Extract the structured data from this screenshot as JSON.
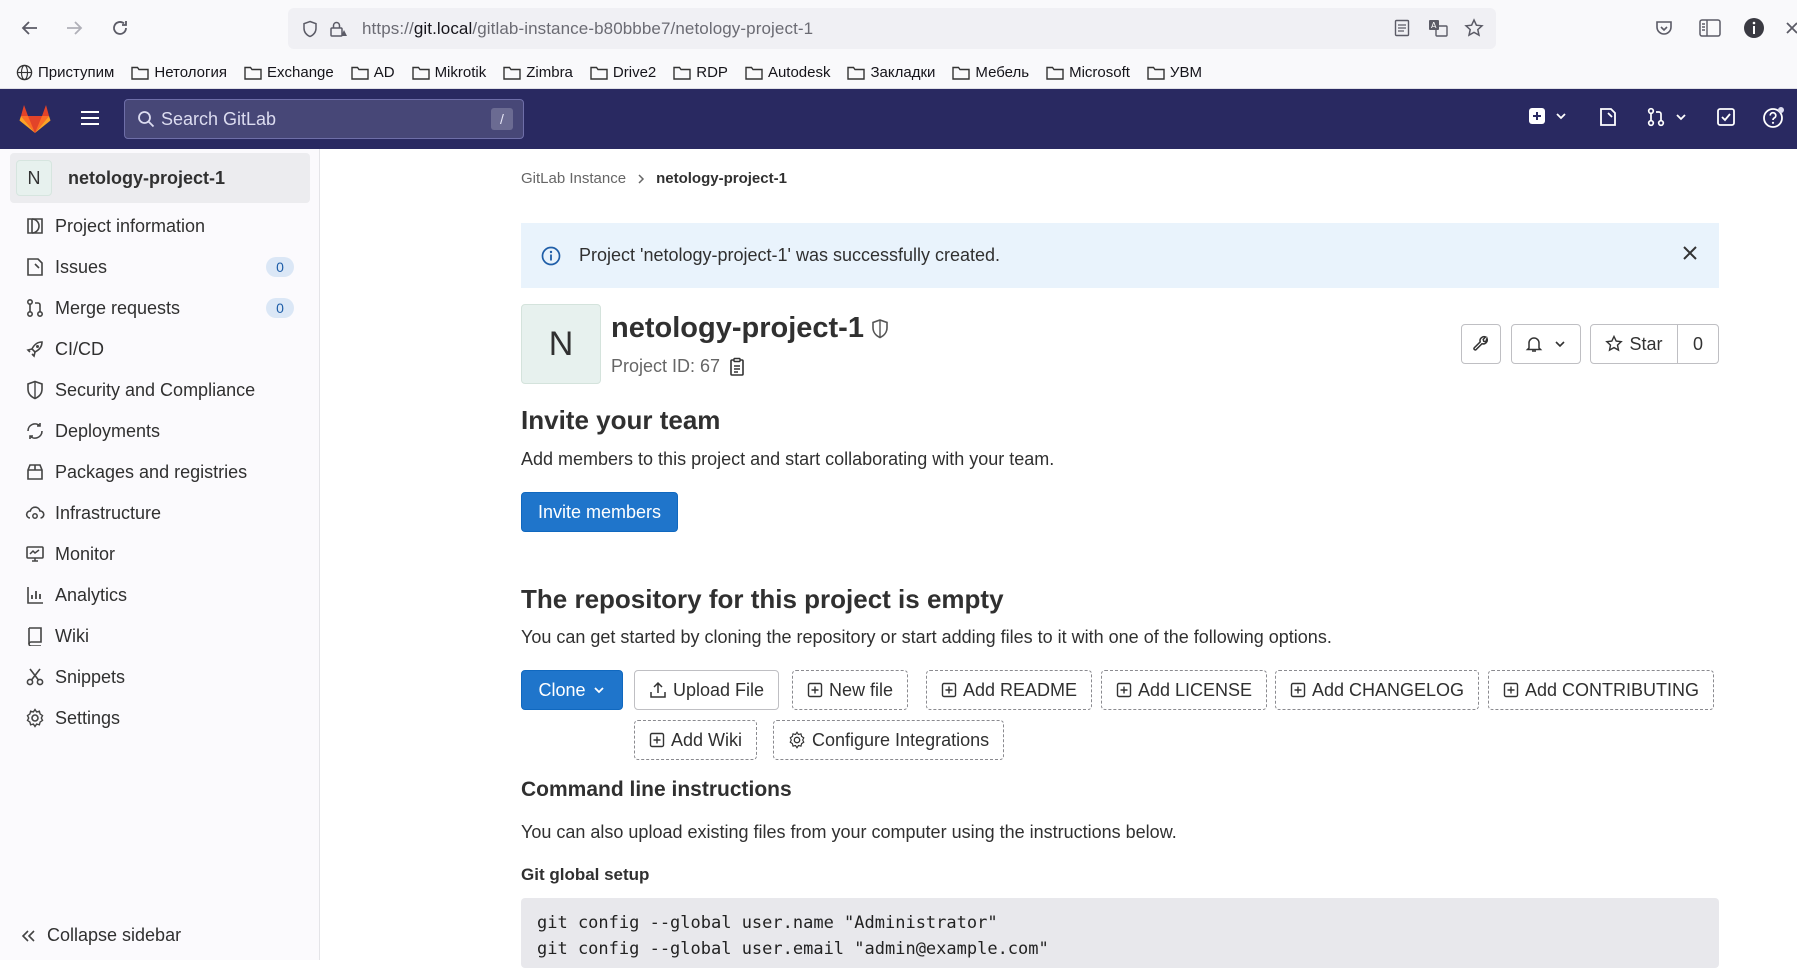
{
  "browser": {
    "url_prefix": "https://",
    "url_host": "git.local",
    "url_path": "/gitlab-instance-b80bbbe7/netology-project-1",
    "bookmarks": [
      {
        "label": "Приступим",
        "icon": "globe-icon"
      },
      {
        "label": "Нетология",
        "icon": "folder-icon"
      },
      {
        "label": "Exchange",
        "icon": "folder-icon"
      },
      {
        "label": "AD",
        "icon": "folder-icon"
      },
      {
        "label": "Mikrotik",
        "icon": "folder-icon"
      },
      {
        "label": "Zimbra",
        "icon": "folder-icon"
      },
      {
        "label": "Drive2",
        "icon": "folder-icon"
      },
      {
        "label": "RDP",
        "icon": "folder-icon"
      },
      {
        "label": "Autodesk",
        "icon": "folder-icon"
      },
      {
        "label": "Закладки",
        "icon": "folder-icon"
      },
      {
        "label": "Мебель",
        "icon": "folder-icon"
      },
      {
        "label": "Microsoft",
        "icon": "folder-icon"
      },
      {
        "label": "УВМ",
        "icon": "folder-icon"
      }
    ]
  },
  "header": {
    "search_placeholder": "Search GitLab",
    "search_shortcut": "/"
  },
  "sidebar": {
    "project_initial": "N",
    "project_name": "netology-project-1",
    "items": [
      {
        "label": "Project information",
        "icon": "info-icon"
      },
      {
        "label": "Issues",
        "icon": "issues-icon",
        "badge": "0"
      },
      {
        "label": "Merge requests",
        "icon": "merge-request-icon",
        "badge": "0"
      },
      {
        "label": "CI/CD",
        "icon": "rocket-icon"
      },
      {
        "label": "Security and Compliance",
        "icon": "shield-icon"
      },
      {
        "label": "Deployments",
        "icon": "deployments-icon"
      },
      {
        "label": "Packages and registries",
        "icon": "package-icon"
      },
      {
        "label": "Infrastructure",
        "icon": "cloud-gear-icon"
      },
      {
        "label": "Monitor",
        "icon": "monitor-icon"
      },
      {
        "label": "Analytics",
        "icon": "chart-icon"
      },
      {
        "label": "Wiki",
        "icon": "book-icon"
      },
      {
        "label": "Snippets",
        "icon": "scissors-icon"
      },
      {
        "label": "Settings",
        "icon": "gear-icon"
      }
    ],
    "collapse_label": "Collapse sidebar"
  },
  "main": {
    "breadcrumb": {
      "parent": "GitLab Instance",
      "current": "netology-project-1"
    },
    "alert": "Project 'netology-project-1' was successfully created.",
    "project": {
      "initial": "N",
      "title": "netology-project-1",
      "id_label": "Project ID: 67",
      "star_label": "Star",
      "star_count": "0"
    },
    "invite": {
      "heading": "Invite your team",
      "text": "Add members to this project and start collaborating with your team.",
      "button": "Invite members"
    },
    "empty": {
      "heading": "The repository for this project is empty",
      "text": "You can get started by cloning the repository or start adding files to it with one of the following options.",
      "clone": "Clone",
      "upload": "Upload File",
      "new_file": "New file",
      "readme": "Add README",
      "license": "Add LICENSE",
      "changelog": "Add CHANGELOG",
      "contributing": "Add CONTRIBUTING",
      "wiki": "Add Wiki",
      "integrations": "Configure Integrations"
    },
    "cli": {
      "heading": "Command line instructions",
      "text": "You can also upload existing files from your computer using the instructions below.",
      "setup_heading": "Git global setup",
      "code": "git config --global user.name \"Administrator\"\ngit config --global user.email \"admin@example.com\""
    }
  }
}
